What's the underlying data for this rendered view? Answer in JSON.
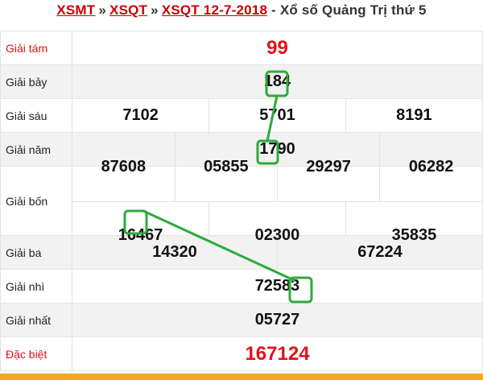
{
  "header": {
    "crumb1": "XSMT",
    "crumb2": "XSQT",
    "crumb3": "XSQT 12-7-2018",
    "sep": "»",
    "title_suffix": "- Xổ số Quảng Trị thứ 5"
  },
  "prizes": {
    "g8": {
      "label": "Giải tám",
      "values": [
        "99"
      ]
    },
    "g7": {
      "label": "Giải bảy",
      "values": [
        "184"
      ]
    },
    "g6": {
      "label": "Giải sáu",
      "values": [
        "7102",
        "5701",
        "8191"
      ]
    },
    "g5": {
      "label": "Giải năm",
      "values": [
        "1790"
      ]
    },
    "g4": {
      "label": "Giải bốn",
      "values": [
        "87608",
        "05855",
        "29297",
        "06282",
        "16467",
        "02300",
        "35835"
      ]
    },
    "g3": {
      "label": "Giải ba",
      "values": [
        "14320",
        "67224"
      ]
    },
    "g2": {
      "label": "Giải nhì",
      "values": [
        "72583"
      ]
    },
    "g1": {
      "label": "Giải nhất",
      "values": [
        "05727"
      ]
    },
    "db": {
      "label": "Đặc biệt",
      "values": [
        "167124"
      ]
    }
  },
  "colors": {
    "accent_red": "#e3101a",
    "link_red": "#cc0000",
    "annotation_green": "#2eaa3c",
    "bottom_bar": "#f5a623"
  }
}
